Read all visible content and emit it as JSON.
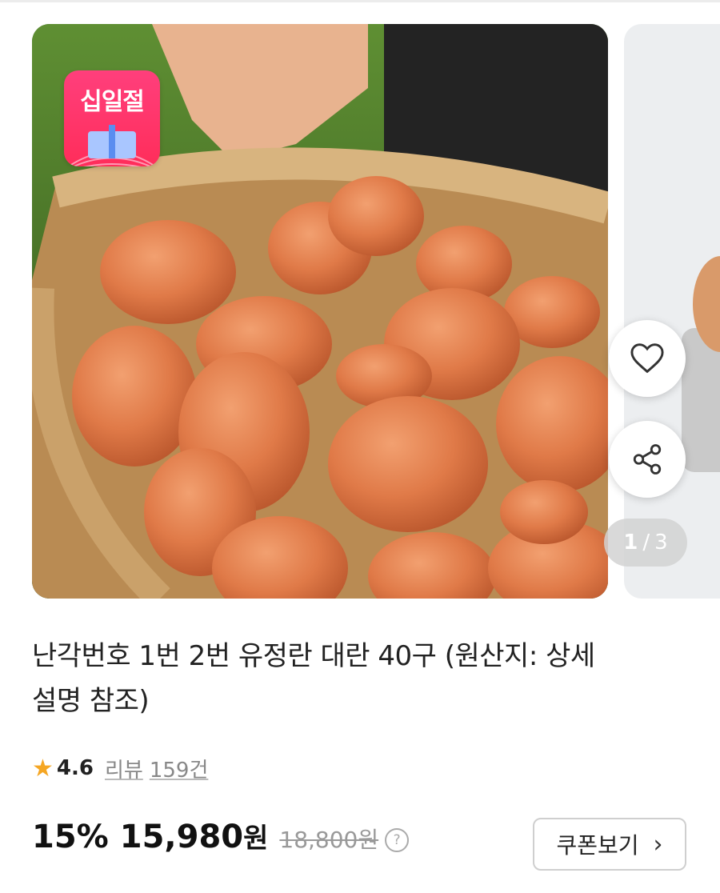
{
  "promo_badge": {
    "text": "십일절"
  },
  "carousel": {
    "current": "1",
    "separator": "/",
    "total": "3"
  },
  "actions": {
    "like_icon": "heart-outline-icon",
    "share_icon": "share-icon"
  },
  "product": {
    "title_line1": "난각번호 1번 2번 유정란 대란 40구 (원산지: 상세",
    "title_line2": "설명 참조)",
    "rating": "4.6",
    "review_label": "리뷰",
    "review_count": "159건",
    "discount": "15%",
    "sale_price": "15,980",
    "sale_unit": "원",
    "original_price": "18,800원",
    "help_symbol": "?"
  },
  "coupon_button": {
    "label": "쿠폰보기",
    "chevron": "›"
  },
  "colors": {
    "star": "#f5a623",
    "badge": "#ff2d5a",
    "egg": "#e07a48"
  }
}
